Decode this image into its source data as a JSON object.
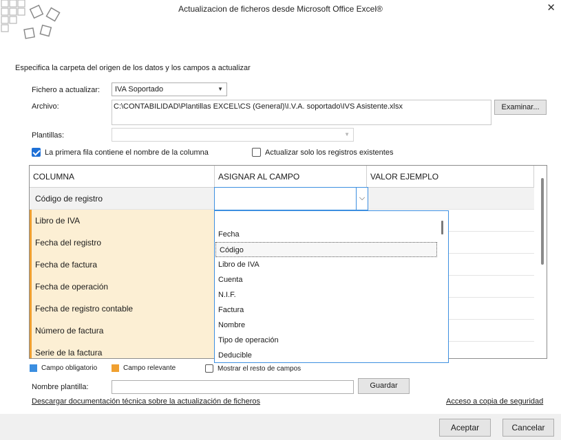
{
  "window": {
    "title": "Actualizacion de ficheros desde Microsoft Office Excel®"
  },
  "intro": "Especifica la carpeta del origen de los datos y los campos a actualizar",
  "form": {
    "fichero_label": "Fichero a actualizar:",
    "fichero_value": "IVA Soportado",
    "archivo_label": "Archivo:",
    "archivo_value": "C:\\CONTABILIDAD\\Plantillas EXCEL\\CS (General)\\I.V.A. soportado\\IVS Asistente.xlsx",
    "examinar_label": "Examinar...",
    "plantillas_label": "Plantillas:",
    "plantillas_value": ""
  },
  "checks": {
    "primera_fila": {
      "label": "La primera fila contiene el nombre de la columna",
      "checked": true
    },
    "solo_existentes": {
      "label": "Actualizar solo los registros existentes",
      "checked": false
    }
  },
  "grid": {
    "headers": [
      "COLUMNA",
      "ASIGNAR AL CAMPO",
      "VALOR EJEMPLO"
    ],
    "rows": [
      "Código de registro",
      "Libro de IVA",
      "Fecha del registro",
      "Fecha de factura",
      "Fecha de operación",
      "Fecha de registro contable",
      "Número de factura",
      "Serie de la factura"
    ]
  },
  "dropdown": {
    "options": [
      "Fecha",
      "Código",
      "Libro de IVA",
      "Cuenta",
      "N.I.F.",
      "Factura",
      "Nombre",
      "Tipo de operación",
      "Deducible"
    ],
    "focused": "Código"
  },
  "legend": {
    "obligatorio": "Campo obligatorio",
    "relevante": "Campo relevante",
    "mostrar_resto": "Mostrar el resto de campos",
    "colors": {
      "obligatorio": "#3b8ee0",
      "relevante": "#f0a030"
    }
  },
  "plantilla": {
    "nombre_label": "Nombre plantilla:",
    "nombre_value": "",
    "guardar_label": "Guardar"
  },
  "links": {
    "documentacion": "Descargar documentación técnica sobre la actualización de ficheros",
    "copia": "Acceso a copia de seguridad"
  },
  "footer": {
    "aceptar": "Aceptar",
    "cancelar": "Cancelar"
  }
}
